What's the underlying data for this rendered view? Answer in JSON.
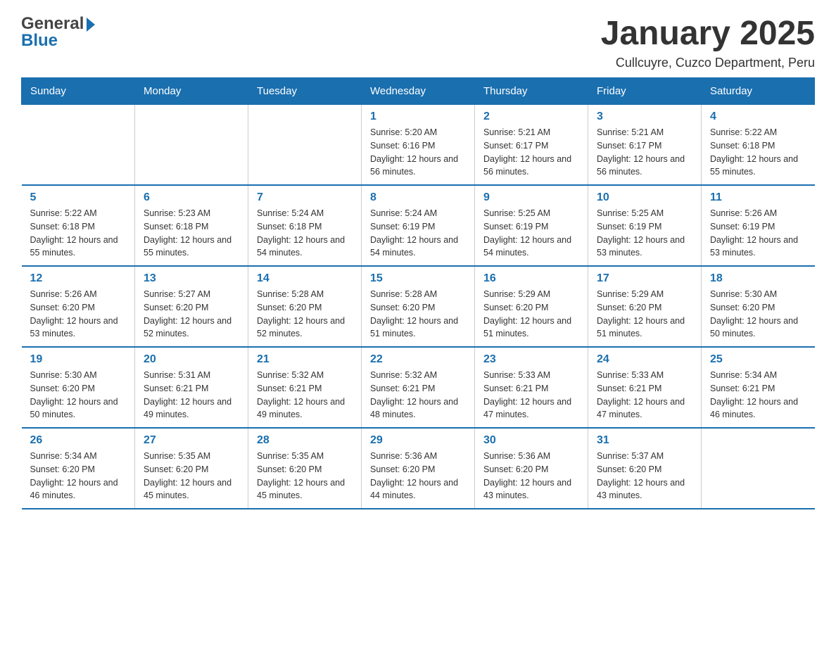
{
  "header": {
    "logo": {
      "general": "General",
      "blue": "Blue"
    },
    "title": "January 2025",
    "subtitle": "Cullcuyre, Cuzco Department, Peru"
  },
  "days_header": [
    "Sunday",
    "Monday",
    "Tuesday",
    "Wednesday",
    "Thursday",
    "Friday",
    "Saturday"
  ],
  "weeks": [
    [
      {
        "day": "",
        "info": ""
      },
      {
        "day": "",
        "info": ""
      },
      {
        "day": "",
        "info": ""
      },
      {
        "day": "1",
        "info": "Sunrise: 5:20 AM\nSunset: 6:16 PM\nDaylight: 12 hours and 56 minutes."
      },
      {
        "day": "2",
        "info": "Sunrise: 5:21 AM\nSunset: 6:17 PM\nDaylight: 12 hours and 56 minutes."
      },
      {
        "day": "3",
        "info": "Sunrise: 5:21 AM\nSunset: 6:17 PM\nDaylight: 12 hours and 56 minutes."
      },
      {
        "day": "4",
        "info": "Sunrise: 5:22 AM\nSunset: 6:18 PM\nDaylight: 12 hours and 55 minutes."
      }
    ],
    [
      {
        "day": "5",
        "info": "Sunrise: 5:22 AM\nSunset: 6:18 PM\nDaylight: 12 hours and 55 minutes."
      },
      {
        "day": "6",
        "info": "Sunrise: 5:23 AM\nSunset: 6:18 PM\nDaylight: 12 hours and 55 minutes."
      },
      {
        "day": "7",
        "info": "Sunrise: 5:24 AM\nSunset: 6:18 PM\nDaylight: 12 hours and 54 minutes."
      },
      {
        "day": "8",
        "info": "Sunrise: 5:24 AM\nSunset: 6:19 PM\nDaylight: 12 hours and 54 minutes."
      },
      {
        "day": "9",
        "info": "Sunrise: 5:25 AM\nSunset: 6:19 PM\nDaylight: 12 hours and 54 minutes."
      },
      {
        "day": "10",
        "info": "Sunrise: 5:25 AM\nSunset: 6:19 PM\nDaylight: 12 hours and 53 minutes."
      },
      {
        "day": "11",
        "info": "Sunrise: 5:26 AM\nSunset: 6:19 PM\nDaylight: 12 hours and 53 minutes."
      }
    ],
    [
      {
        "day": "12",
        "info": "Sunrise: 5:26 AM\nSunset: 6:20 PM\nDaylight: 12 hours and 53 minutes."
      },
      {
        "day": "13",
        "info": "Sunrise: 5:27 AM\nSunset: 6:20 PM\nDaylight: 12 hours and 52 minutes."
      },
      {
        "day": "14",
        "info": "Sunrise: 5:28 AM\nSunset: 6:20 PM\nDaylight: 12 hours and 52 minutes."
      },
      {
        "day": "15",
        "info": "Sunrise: 5:28 AM\nSunset: 6:20 PM\nDaylight: 12 hours and 51 minutes."
      },
      {
        "day": "16",
        "info": "Sunrise: 5:29 AM\nSunset: 6:20 PM\nDaylight: 12 hours and 51 minutes."
      },
      {
        "day": "17",
        "info": "Sunrise: 5:29 AM\nSunset: 6:20 PM\nDaylight: 12 hours and 51 minutes."
      },
      {
        "day": "18",
        "info": "Sunrise: 5:30 AM\nSunset: 6:20 PM\nDaylight: 12 hours and 50 minutes."
      }
    ],
    [
      {
        "day": "19",
        "info": "Sunrise: 5:30 AM\nSunset: 6:20 PM\nDaylight: 12 hours and 50 minutes."
      },
      {
        "day": "20",
        "info": "Sunrise: 5:31 AM\nSunset: 6:21 PM\nDaylight: 12 hours and 49 minutes."
      },
      {
        "day": "21",
        "info": "Sunrise: 5:32 AM\nSunset: 6:21 PM\nDaylight: 12 hours and 49 minutes."
      },
      {
        "day": "22",
        "info": "Sunrise: 5:32 AM\nSunset: 6:21 PM\nDaylight: 12 hours and 48 minutes."
      },
      {
        "day": "23",
        "info": "Sunrise: 5:33 AM\nSunset: 6:21 PM\nDaylight: 12 hours and 47 minutes."
      },
      {
        "day": "24",
        "info": "Sunrise: 5:33 AM\nSunset: 6:21 PM\nDaylight: 12 hours and 47 minutes."
      },
      {
        "day": "25",
        "info": "Sunrise: 5:34 AM\nSunset: 6:21 PM\nDaylight: 12 hours and 46 minutes."
      }
    ],
    [
      {
        "day": "26",
        "info": "Sunrise: 5:34 AM\nSunset: 6:20 PM\nDaylight: 12 hours and 46 minutes."
      },
      {
        "day": "27",
        "info": "Sunrise: 5:35 AM\nSunset: 6:20 PM\nDaylight: 12 hours and 45 minutes."
      },
      {
        "day": "28",
        "info": "Sunrise: 5:35 AM\nSunset: 6:20 PM\nDaylight: 12 hours and 45 minutes."
      },
      {
        "day": "29",
        "info": "Sunrise: 5:36 AM\nSunset: 6:20 PM\nDaylight: 12 hours and 44 minutes."
      },
      {
        "day": "30",
        "info": "Sunrise: 5:36 AM\nSunset: 6:20 PM\nDaylight: 12 hours and 43 minutes."
      },
      {
        "day": "31",
        "info": "Sunrise: 5:37 AM\nSunset: 6:20 PM\nDaylight: 12 hours and 43 minutes."
      },
      {
        "day": "",
        "info": ""
      }
    ]
  ]
}
